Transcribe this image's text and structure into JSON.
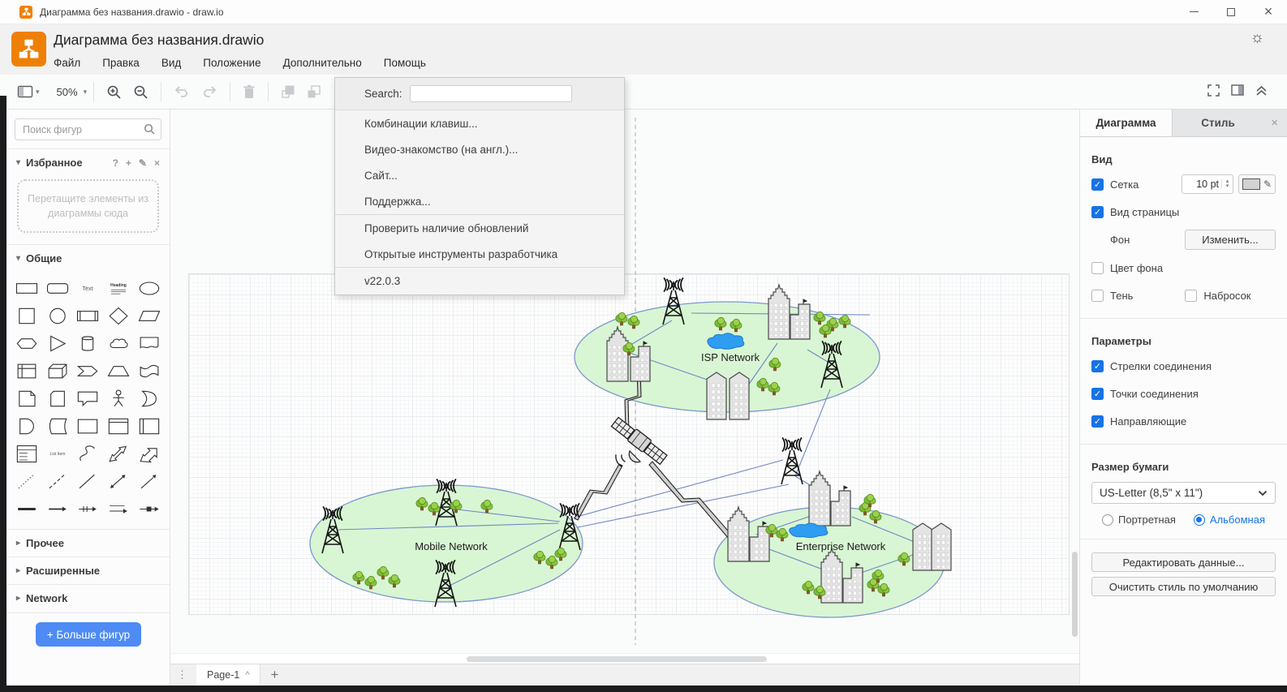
{
  "title_bar": {
    "title": "Диаграмма без названия.drawio - draw.io"
  },
  "header": {
    "title": "Диаграмма без названия.drawio",
    "menus": [
      "Файл",
      "Правка",
      "Вид",
      "Положение",
      "Дополнительно",
      "Помощь"
    ]
  },
  "toolbar": {
    "zoom": "50%"
  },
  "help_menu": {
    "search_label": "Search:",
    "items": [
      "Комбинации клавиш...",
      "Видео-знакомство (на англ.)...",
      "Сайт...",
      "Поддержка...",
      "Проверить наличие обновлений",
      "Открытые инструменты разработчика"
    ],
    "version": "v22.0.3"
  },
  "sidebar": {
    "search_placeholder": "Поиск фигур",
    "favorites_label": "Избранное",
    "dropzone_text": "Перетащите элементы из диаграммы сюда",
    "general_label": "Общие",
    "collapsed_sections": [
      "Прочее",
      "Расширенные",
      "Network"
    ],
    "more_shapes_label": "+ Больше фигур",
    "shape_texts": {
      "text": "Text",
      "heading": "Heading",
      "list_item": "List Item"
    },
    "shape_names": [
      "rectangle",
      "rounded-rectangle",
      "text",
      "heading",
      "ellipse",
      "square",
      "circle",
      "process",
      "diamond",
      "parallelogram",
      "hexagon",
      "triangle",
      "cylinder",
      "cloud",
      "document",
      "internal-storage",
      "cube",
      "step",
      "trapezoid",
      "tape",
      "note",
      "card",
      "callout",
      "actor",
      "or",
      "and",
      "data-storage",
      "container",
      "window",
      "vertical-container",
      "list",
      "list-item",
      "curve",
      "bidirectional-arrow",
      "arrow",
      "dotted-line",
      "dashed-line",
      "line",
      "bidirectional-connector",
      "directional-connector",
      "bold-line",
      "link",
      "link-arrow",
      "connector-arrow",
      "connector-symbol"
    ]
  },
  "canvas": {
    "isp_label": "ISP Network",
    "mobile_label": "Mobile Network",
    "enterprise_label": "Enterprise Network"
  },
  "right_panel": {
    "tabs": {
      "diagram": "Диаграмма",
      "style": "Стиль"
    },
    "view": {
      "title": "Вид",
      "grid_label": "Сетка",
      "grid_on": true,
      "grid_size": "10 pt",
      "page_view_label": "Вид страницы",
      "page_view_on": true,
      "background_label": "Фон",
      "change_button": "Изменить...",
      "bg_color_label": "Цвет фона",
      "bg_color_on": false,
      "shadow_label": "Тень",
      "shadow_on": false,
      "sketch_label": "Набросок",
      "sketch_on": false
    },
    "options": {
      "title": "Параметры",
      "items": [
        "Стрелки соединения",
        "Точки соединения",
        "Направляющие"
      ],
      "states": [
        true,
        true,
        true
      ]
    },
    "paper": {
      "title": "Размер бумаги",
      "size": "US-Letter (8,5\" x 11\")",
      "portrait": "Портретная",
      "landscape": "Альбомная"
    },
    "buttons": [
      "Редактировать данные...",
      "Очистить стиль по умолчанию"
    ]
  },
  "footer": {
    "page_tab": "Page-1"
  },
  "glyphs": {
    "close": "×",
    "dropdown": "▾",
    "collapsed": "▸",
    "expanded": "▾",
    "up_caret": "^",
    "plus": "+",
    "question": "?",
    "pencil": "✎",
    "dots": "⋮",
    "sun": "☼",
    "spin_up": "▴",
    "spin_down": "▾"
  },
  "colors": {
    "accent_blue": "#1673e6",
    "button_blue": "#4e8bf5",
    "app_orange": "#ef8006",
    "node_fill": "#d8f6d3",
    "node_stroke": "#7e97cc",
    "link_line": "#6f87c4"
  }
}
